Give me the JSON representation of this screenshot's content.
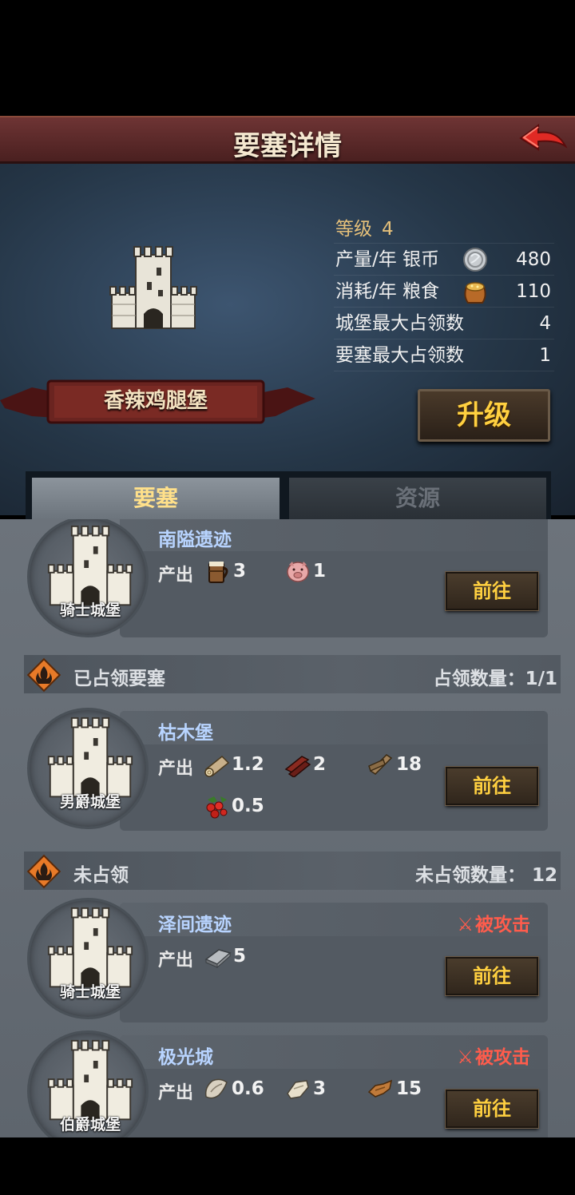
{
  "header": {
    "title": "要塞详情"
  },
  "fortress": {
    "name": "香辣鸡腿堡",
    "level_label": "等级",
    "level": "4",
    "production_label": "产量/年 银币",
    "production_value": "480",
    "consumption_label": "消耗/年 粮食",
    "consumption_value": "110",
    "max_castle_label": "城堡最大占领数",
    "max_castle_value": "4",
    "max_fortress_label": "要塞最大占领数",
    "max_fortress_value": "1",
    "upgrade_label": "升级"
  },
  "tabs": [
    {
      "label": "要塞"
    },
    {
      "label": "资源"
    }
  ],
  "common": {
    "output_label": "产出",
    "go_label": "前往",
    "under_attack": "被攻击"
  },
  "cards": [
    {
      "name": "南隘遗迹",
      "badge": "骑士城堡",
      "outputs": [
        {
          "icon": "mug-icon",
          "value": "3"
        },
        {
          "icon": "pig-icon",
          "value": "1"
        }
      ]
    },
    {
      "name": "枯木堡",
      "badge": "男爵城堡",
      "outputs": [
        {
          "icon": "log-icon",
          "value": "1.2"
        },
        {
          "icon": "red-plank-icon",
          "value": "2"
        },
        {
          "icon": "lumber-icon",
          "value": "18"
        },
        {
          "icon": "berries-icon",
          "value": "0.5"
        }
      ]
    },
    {
      "name": "泽间遗迹",
      "badge": "骑士城堡",
      "outputs": [
        {
          "icon": "iron-ingot-icon",
          "value": "5"
        }
      ]
    },
    {
      "name": "极光城",
      "badge": "伯爵城堡",
      "outputs": [
        {
          "icon": "fur-icon",
          "value": "0.6"
        },
        {
          "icon": "cloth-icon",
          "value": "3"
        },
        {
          "icon": "leather-icon",
          "value": "15"
        }
      ]
    }
  ],
  "sections": {
    "occupied": {
      "title": "已占领要塞",
      "count_label": "占领数量：1/1"
    },
    "unoccupied": {
      "title": "未占领",
      "count_label": "未占领数量： 12"
    }
  },
  "colors": {
    "header_bg": "#5a2828",
    "upgrade_text": "#ffd040",
    "card_name": "#b8d4ff",
    "attack_red": "#ff5c4c"
  }
}
